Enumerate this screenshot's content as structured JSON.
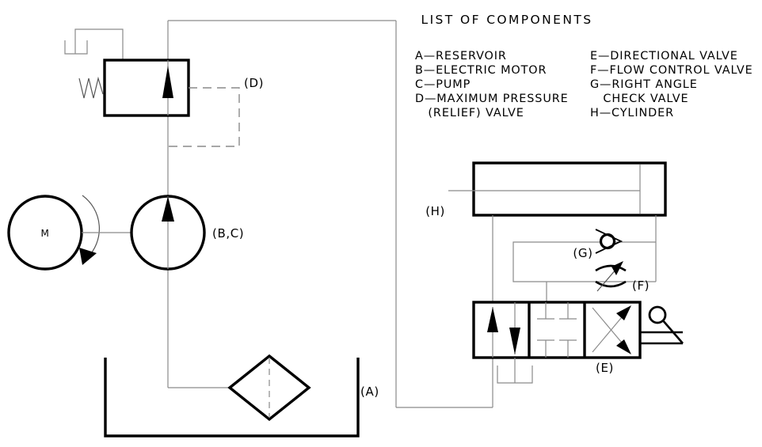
{
  "legend": {
    "title": "LIST OF COMPONENTS",
    "column_left": [
      "A—RESERVOIR",
      "B—ELECTRIC MOTOR",
      "C—PUMP",
      "D—MAXIMUM PRESSURE",
      "   (RELIEF) VALVE"
    ],
    "column_right": [
      "E—DIRECTIONAL VALVE",
      "F—FLOW CONTROL VALVE",
      "G—RIGHT ANGLE",
      "   CHECK VALVE",
      "H—CYLINDER"
    ]
  },
  "callouts": {
    "reservoir": "(A)",
    "motor_pump": "(B,C)",
    "relief_valve": "(D)",
    "directional_valve": "(E)",
    "flow_control_valve": "(F)",
    "check_valve": "(G)",
    "cylinder": "(H)"
  },
  "symbols": {
    "motor_letter": "M"
  },
  "colors": {
    "line": "#000000",
    "thin_line": "#8a8a8a",
    "background": "#ffffff"
  }
}
